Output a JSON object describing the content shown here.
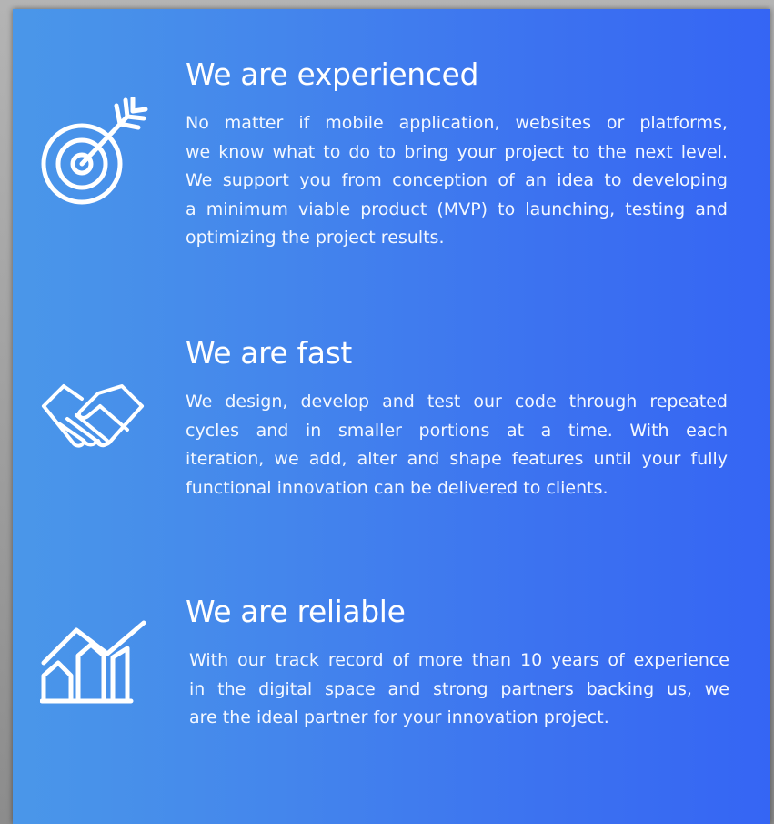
{
  "sections": [
    {
      "icon": "target-arrow-icon",
      "title": "We are experienced",
      "lines": [
        "No matter if mobile application, websites or platforms,",
        "we know what to do to bring your project to the next level.",
        "We support you from conception of an idea to developing",
        "a minimum viable product (MVP) to launching, testing and",
        "optimizing the project results."
      ]
    },
    {
      "icon": "handshake-icon",
      "title": "We are fast",
      "lines": [
        "We design, develop and test our code through repeated",
        "cycles and in smaller portions at a time. With each",
        "iteration, we add, alter and shape features until your fully",
        "functional innovation can be delivered  to clients."
      ]
    },
    {
      "icon": "growth-chart-icon",
      "title": "We are reliable",
      "lines": [
        "With our track record of more than 10 years of experience",
        "in the digital space and strong partners backing us, we",
        "are the ideal partner for your innovation project."
      ]
    }
  ],
  "colors": {
    "panel_gradient_start": "#4a97e9",
    "panel_gradient_end": "#3565f4",
    "text": "#ffffff"
  }
}
